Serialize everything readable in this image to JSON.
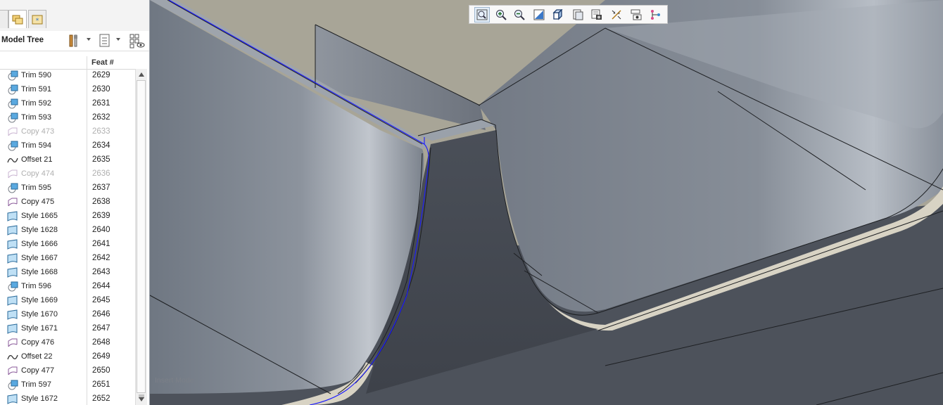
{
  "model_tree": {
    "title": "Model Tree",
    "column_header": "Feat #",
    "rows": [
      {
        "label": "Trim 590",
        "feat": "2629",
        "icon": "trim-icon",
        "dim": false
      },
      {
        "label": "Trim 591",
        "feat": "2630",
        "icon": "trim-icon",
        "dim": false
      },
      {
        "label": "Trim 592",
        "feat": "2631",
        "icon": "trim-icon",
        "dim": false
      },
      {
        "label": "Trim 593",
        "feat": "2632",
        "icon": "trim-icon",
        "dim": false
      },
      {
        "label": "Copy 473",
        "feat": "2633",
        "icon": "copy-icon",
        "dim": true
      },
      {
        "label": "Trim 594",
        "feat": "2634",
        "icon": "trim-icon",
        "dim": false
      },
      {
        "label": "Offset 21",
        "feat": "2635",
        "icon": "offset-icon",
        "dim": false
      },
      {
        "label": "Copy 474",
        "feat": "2636",
        "icon": "copy-icon",
        "dim": true
      },
      {
        "label": "Trim 595",
        "feat": "2637",
        "icon": "trim-icon",
        "dim": false
      },
      {
        "label": "Copy 475",
        "feat": "2638",
        "icon": "copy-icon",
        "dim": false
      },
      {
        "label": "Style 1665",
        "feat": "2639",
        "icon": "style-icon",
        "dim": false
      },
      {
        "label": "Style 1628",
        "feat": "2640",
        "icon": "style-icon",
        "dim": false
      },
      {
        "label": "Style 1666",
        "feat": "2641",
        "icon": "style-icon",
        "dim": false
      },
      {
        "label": "Style 1667",
        "feat": "2642",
        "icon": "style-icon",
        "dim": false
      },
      {
        "label": "Style 1668",
        "feat": "2643",
        "icon": "style-icon",
        "dim": false
      },
      {
        "label": "Trim 596",
        "feat": "2644",
        "icon": "trim-icon",
        "dim": false
      },
      {
        "label": "Style 1669",
        "feat": "2645",
        "icon": "style-icon",
        "dim": false
      },
      {
        "label": "Style 1670",
        "feat": "2646",
        "icon": "style-icon",
        "dim": false
      },
      {
        "label": "Style 1671",
        "feat": "2647",
        "icon": "style-icon",
        "dim": false
      },
      {
        "label": "Copy 476",
        "feat": "2648",
        "icon": "copy-icon",
        "dim": false
      },
      {
        "label": "Offset 22",
        "feat": "2649",
        "icon": "offset-icon",
        "dim": false
      },
      {
        "label": "Copy 477",
        "feat": "2650",
        "icon": "copy-icon",
        "dim": false
      },
      {
        "label": "Trim 597",
        "feat": "2651",
        "icon": "trim-icon",
        "dim": false
      },
      {
        "label": "Style 1672",
        "feat": "2652",
        "icon": "style-icon",
        "dim": false
      }
    ]
  },
  "view_toolbar": {
    "buttons": [
      "refit-icon",
      "zoom-in-icon",
      "zoom-out-icon",
      "repaint-icon",
      "display-style-icon",
      "saved-views-icon",
      "view-manager-icon",
      "datum-display-icon",
      "spin-center-icon",
      "annotation-icon"
    ]
  },
  "status": {
    "mode": "Insert Mode"
  },
  "colors": {
    "surface": "#7d8590",
    "background": "#a8a597",
    "selection_blue": "#1a1aff"
  }
}
